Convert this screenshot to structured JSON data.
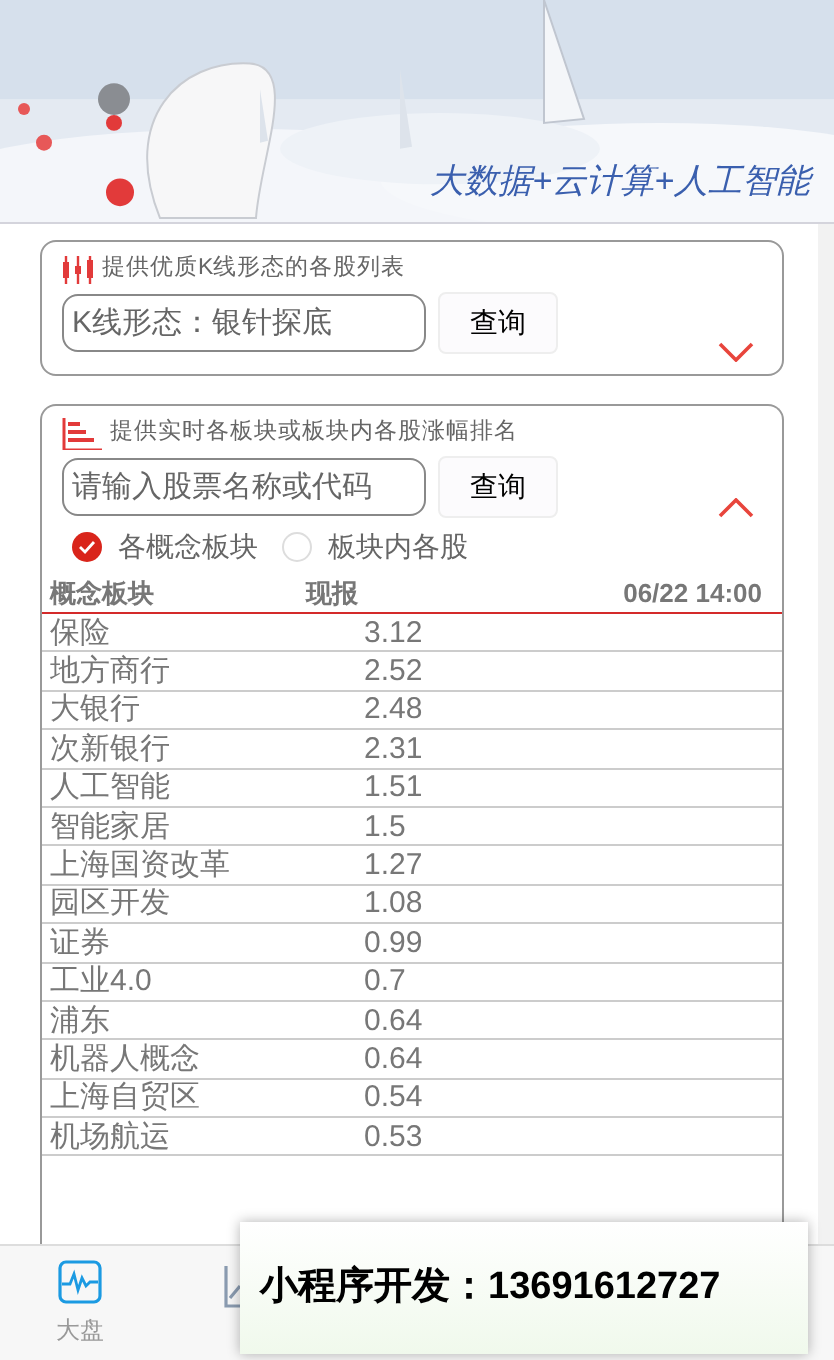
{
  "banner": {
    "slogan": "大数据+云计算+人工智能"
  },
  "kline_card": {
    "description": "提供优质K线形态的各股列表",
    "field": {
      "value": "K线形态：银针探底"
    },
    "button": "查询",
    "expanded": false
  },
  "sector_card": {
    "description": "提供实时各板块或板块内各股涨幅排名",
    "field": {
      "placeholder": "请输入股票名称或代码"
    },
    "button": "查询",
    "expanded": true,
    "options": [
      {
        "label": "各概念板块",
        "selected": true
      },
      {
        "label": "板块内各股",
        "selected": false
      }
    ],
    "table": {
      "columns": [
        "概念板块",
        "现报",
        "06/22 14:00"
      ],
      "rows": [
        [
          "保险",
          "3.12"
        ],
        [
          "地方商行",
          "2.52"
        ],
        [
          "大银行",
          "2.48"
        ],
        [
          "次新银行",
          "2.31"
        ],
        [
          "人工智能",
          "1.51"
        ],
        [
          "智能家居",
          "1.5"
        ],
        [
          "上海国资改革",
          "1.27"
        ],
        [
          "园区开发",
          "1.08"
        ],
        [
          "证券",
          "0.99"
        ],
        [
          "工业4.0",
          "0.7"
        ],
        [
          "浦东",
          "0.64"
        ],
        [
          "机器人概念",
          "0.64"
        ],
        [
          "上海自贸区",
          "0.54"
        ],
        [
          "机场航运",
          "0.53"
        ]
      ]
    }
  },
  "tab_bar": [
    {
      "label": "大盘",
      "selected": true
    },
    {
      "selected": false
    }
  ],
  "toast": "小程序开发：13691612727"
}
